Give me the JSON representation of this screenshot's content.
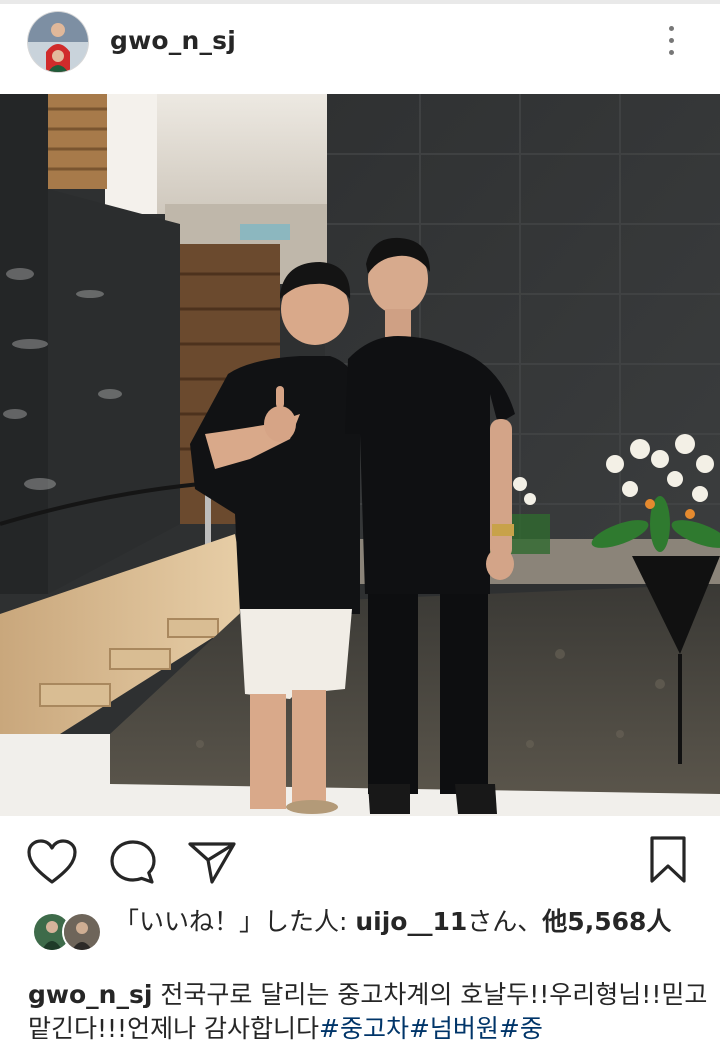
{
  "post": {
    "username": "gwo_n_sj",
    "likes": {
      "prefix": "「いいね！」した人: ",
      "user": "uijo__11",
      "suffix": "さん、",
      "others": "他5,568人"
    },
    "caption": {
      "username": "gwo_n_sj",
      "text": "전국구로 달리는 중고차계의 호날두!!우리형님!!믿고맡긴다!!!언제나 감사합니다",
      "tags": "#중고차#넘버원#중"
    }
  },
  "icons": {
    "more": "more-vertical-icon",
    "like": "heart-icon",
    "comment": "comment-bubble-icon",
    "share": "paper-plane-icon",
    "save": "bookmark-icon"
  },
  "colors": {
    "text": "#262626",
    "hashtag": "#003569",
    "icon": "#262626"
  }
}
